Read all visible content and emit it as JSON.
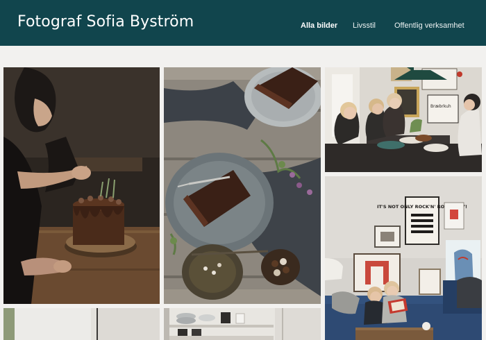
{
  "site": {
    "title": "Fotograf Sofia Byström"
  },
  "nav": {
    "items": [
      {
        "label": "Alla bilder",
        "active": true
      },
      {
        "label": "Livsstil",
        "active": false
      },
      {
        "label": "Offentlig verksamhet",
        "active": false
      }
    ]
  },
  "gallery": {
    "poster_text": "IT'S NOT ONLY ROCK'N' ROLL BABY!",
    "sign_text": "Bræbrkuh"
  },
  "colors": {
    "header_bg": "#11454d",
    "page_bg": "#f2f1ef"
  }
}
